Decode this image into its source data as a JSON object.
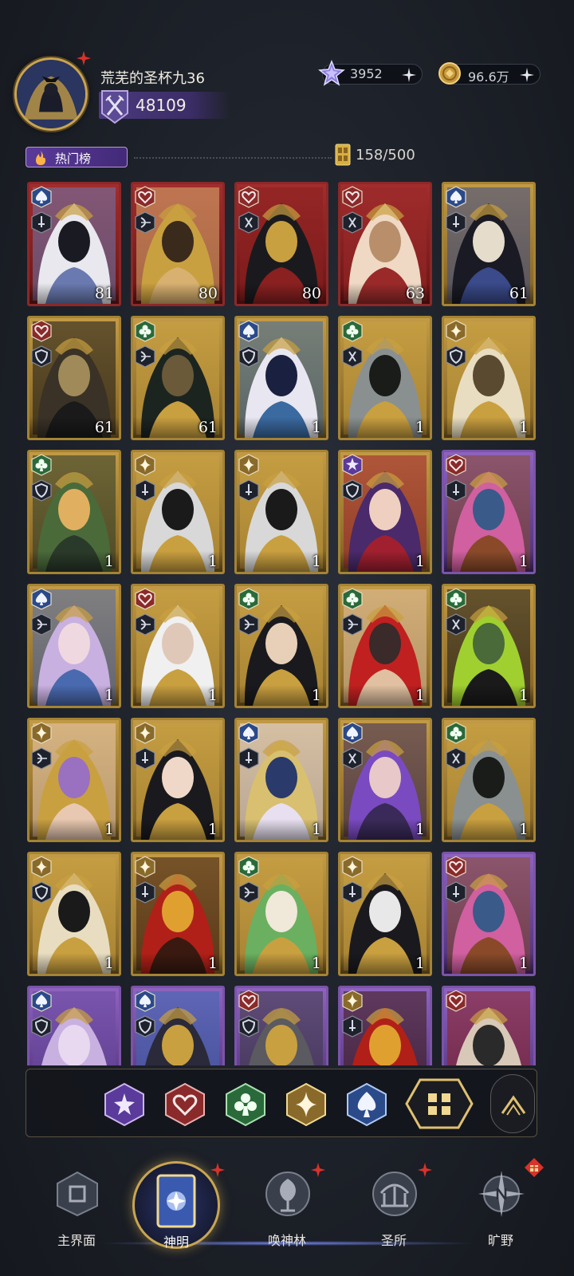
{
  "header": {
    "player_name": "荒芜的圣杯九36",
    "power": "48109",
    "crystals": "3952",
    "gold": "96.6万"
  },
  "filter": {
    "hot_label": "热门榜",
    "capacity": "158/500"
  },
  "cards": [
    {
      "level": "81",
      "frame": "red",
      "suit": "spade",
      "role": "sword",
      "palette": [
        "#e8e8ee",
        "#1a1a22",
        "#6a7ab0"
      ]
    },
    {
      "level": "80",
      "frame": "red",
      "suit": "heart",
      "role": "bow",
      "palette": [
        "#c9a040",
        "#3a2a1c",
        "#d8b070"
      ]
    },
    {
      "level": "80",
      "frame": "red",
      "suit": "heart",
      "role": "axe",
      "palette": [
        "#1a1a1e",
        "#c9a040",
        "#8a2020"
      ]
    },
    {
      "level": "63",
      "frame": "red",
      "suit": "heart",
      "role": "axe",
      "palette": [
        "#efd9c4",
        "#b88f6a",
        "#9a2a2a"
      ]
    },
    {
      "level": "61",
      "frame": "gold",
      "suit": "spade",
      "role": "sword",
      "palette": [
        "#1a1a24",
        "#e6dccb",
        "#3a4a8a"
      ]
    },
    {
      "level": "61",
      "frame": "gold",
      "suit": "heart",
      "role": "shield",
      "palette": [
        "#3a3226",
        "#a08a5a",
        "#1a1a1a"
      ]
    },
    {
      "level": "61",
      "frame": "gold",
      "suit": "club",
      "role": "bow",
      "palette": [
        "#1c2420",
        "#6a5a3a",
        "#c9a040"
      ]
    },
    {
      "level": "1",
      "frame": "gold",
      "suit": "spade",
      "role": "shield",
      "palette": [
        "#e8e6f0",
        "#1a2040",
        "#3a6aa0"
      ]
    },
    {
      "level": "1",
      "frame": "gold",
      "suit": "club",
      "role": "axe",
      "palette": [
        "#8a9090",
        "#1a1c1a",
        "#c9a040"
      ]
    },
    {
      "level": "1",
      "frame": "gold",
      "suit": "diamond",
      "role": "shield",
      "palette": [
        "#e8ddc0",
        "#5a4a30",
        "#c9a040"
      ]
    },
    {
      "level": "1",
      "frame": "gold",
      "suit": "club",
      "role": "shield",
      "palette": [
        "#4a6a3a",
        "#e0b060",
        "#2a3a2a"
      ]
    },
    {
      "level": "1",
      "frame": "gold",
      "suit": "diamond",
      "role": "sword",
      "palette": [
        "#d8d8d8",
        "#1a1a1a",
        "#c9a040"
      ]
    },
    {
      "level": "1",
      "frame": "gold",
      "suit": "diamond",
      "role": "sword",
      "palette": [
        "#d8d8d8",
        "#1a1a1a",
        "#c9a040"
      ]
    },
    {
      "level": "1",
      "frame": "gold",
      "suit": "star",
      "role": "shield",
      "palette": [
        "#4a2a6a",
        "#efd0c0",
        "#a02030"
      ]
    },
    {
      "level": "1",
      "frame": "purp",
      "suit": "heart",
      "role": "sword",
      "palette": [
        "#d060a0",
        "#3a5a8a",
        "#8a4a2a"
      ]
    },
    {
      "level": "1",
      "frame": "gold",
      "suit": "spade",
      "role": "bow",
      "palette": [
        "#c8b0e0",
        "#f0d8e0",
        "#4a6ab0"
      ]
    },
    {
      "level": "1",
      "frame": "gold",
      "suit": "heart",
      "role": "bow",
      "palette": [
        "#f0f0f0",
        "#e0c8b8",
        "#c9a040"
      ]
    },
    {
      "level": "1",
      "frame": "gold",
      "suit": "club",
      "role": "bow",
      "palette": [
        "#1a1a1e",
        "#e8d0b8",
        "#c9a040"
      ]
    },
    {
      "level": "1",
      "frame": "gold",
      "suit": "club",
      "role": "bow",
      "palette": [
        "#c02020",
        "#3a2a2a",
        "#e0c0a0"
      ]
    },
    {
      "level": "1",
      "frame": "gold",
      "suit": "club",
      "role": "axe",
      "palette": [
        "#a0d030",
        "#4a6a3a",
        "#1a1a1a"
      ]
    },
    {
      "level": "1",
      "frame": "gold",
      "suit": "diamond",
      "role": "bow",
      "palette": [
        "#c9a040",
        "#9a70c0",
        "#e8c8b0"
      ]
    },
    {
      "level": "1",
      "frame": "gold",
      "suit": "diamond",
      "role": "sword",
      "palette": [
        "#1a1a1e",
        "#f0d8c8",
        "#c9a040"
      ]
    },
    {
      "level": "1",
      "frame": "gold",
      "suit": "spade",
      "role": "sword",
      "palette": [
        "#d8c070",
        "#2a3a6a",
        "#e8e0f0"
      ]
    },
    {
      "level": "1",
      "frame": "gold",
      "suit": "spade",
      "role": "axe",
      "palette": [
        "#7a4ac0",
        "#e8c8c8",
        "#3a2a5a"
      ]
    },
    {
      "level": "1",
      "frame": "gold",
      "suit": "club",
      "role": "axe",
      "palette": [
        "#8a9090",
        "#1a1c1a",
        "#c9a040"
      ]
    },
    {
      "level": "1",
      "frame": "gold",
      "suit": "diamond",
      "role": "shield",
      "palette": [
        "#e8ddc0",
        "#1a1a1a",
        "#c9a040"
      ]
    },
    {
      "level": "1",
      "frame": "gold",
      "suit": "diamond",
      "role": "sword",
      "palette": [
        "#b02018",
        "#e0a030",
        "#3a1a10"
      ]
    },
    {
      "level": "1",
      "frame": "gold",
      "suit": "club",
      "role": "bow",
      "palette": [
        "#6ab060",
        "#f0e8d8",
        "#c9a040"
      ]
    },
    {
      "level": "1",
      "frame": "gold",
      "suit": "diamond",
      "role": "sword",
      "palette": [
        "#1a1a1e",
        "#e8e8e8",
        "#c9a040"
      ]
    },
    {
      "level": "1",
      "frame": "purp",
      "suit": "heart",
      "role": "sword",
      "palette": [
        "#d060a0",
        "#3a5a8a",
        "#8a4a2a"
      ]
    },
    {
      "level": "",
      "frame": "purp",
      "suit": "spade",
      "role": "shield",
      "palette": [
        "#c8b0e0",
        "#e8d8f0",
        "#6a4aa0"
      ]
    },
    {
      "level": "",
      "frame": "purp",
      "suit": "spade",
      "role": "shield",
      "palette": [
        "#2a2a3a",
        "#c9a040",
        "#3a6ab0"
      ]
    },
    {
      "level": "",
      "frame": "purp",
      "suit": "heart",
      "role": "shield",
      "palette": [
        "#5a5a60",
        "#c9a040",
        "#3a3a40"
      ]
    },
    {
      "level": "",
      "frame": "purp",
      "suit": "diamond",
      "role": "sword",
      "palette": [
        "#b02018",
        "#e0a030",
        "#3a1a10"
      ]
    },
    {
      "level": "",
      "frame": "purp",
      "suit": "heart",
      "role": "none",
      "palette": [
        "#d8c8b8",
        "#2a2a2a",
        "#8a2020"
      ]
    }
  ],
  "filterbar": {
    "buttons": [
      "star",
      "heart",
      "club",
      "diamond",
      "spade",
      "all"
    ]
  },
  "nav": {
    "items": [
      {
        "label": "主界面",
        "icon": "home-icon",
        "badge": false
      },
      {
        "label": "神明",
        "icon": "card-book-icon",
        "badge": true
      },
      {
        "label": "唤神林",
        "icon": "tree-icon",
        "badge": true
      },
      {
        "label": "圣所",
        "icon": "sanctuary-icon",
        "badge": true
      },
      {
        "label": "旷野",
        "icon": "compass-icon",
        "badge": true
      }
    ]
  },
  "colors": {
    "accent_gold": "#c9a552",
    "accent_purple": "#5a3a9a",
    "badge_red": "#d8322a"
  }
}
